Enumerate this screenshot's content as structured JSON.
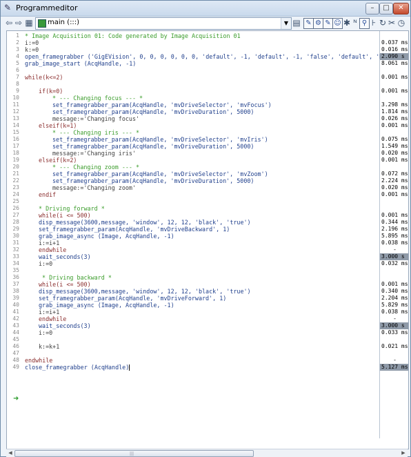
{
  "window": {
    "title": "Programmeditor"
  },
  "toolbar": {
    "procedure": "main (:::)"
  },
  "code_lines": [
    {
      "n": "1",
      "t": "* Image Acquisition 01: Code generated by Image Acquisition 01",
      "k": "c-comment",
      "i": 0,
      "time": ""
    },
    {
      "n": "2",
      "t": "i:=0",
      "k": "c-assign",
      "i": 0,
      "time": "0.037 ms"
    },
    {
      "n": "3",
      "t": "k:=0",
      "k": "c-assign",
      "i": 0,
      "time": "0.016 ms"
    },
    {
      "n": "4",
      "t": "open_framegrabber ('GigEVision', 0, 0, 0, 0, 0, 0, 'default', -1, 'default', -1, 'false', 'default', 'D'",
      "k": "c-op",
      "i": 0,
      "time": "2.090 s",
      "hl": true
    },
    {
      "n": "5",
      "t": "grab_image_start (AcqHandle, -1)",
      "k": "c-op",
      "i": 0,
      "time": "8.061 ms"
    },
    {
      "n": "6",
      "t": "",
      "k": "",
      "i": 0,
      "time": ""
    },
    {
      "n": "7",
      "t": "while(k<=2)",
      "k": "c-kw",
      "i": 0,
      "time": "0.001 ms"
    },
    {
      "n": "8",
      "t": "",
      "k": "",
      "i": 0,
      "time": ""
    },
    {
      "n": "9",
      "t": "if(k=0)",
      "k": "c-kw",
      "i": 1,
      "time": "0.001 ms"
    },
    {
      "n": "10",
      "t": "* --- Changing focus --- *",
      "k": "c-comment",
      "i": 2,
      "time": ""
    },
    {
      "n": "11",
      "t": "set_framegrabber_param(AcqHandle, 'mvDriveSelector', 'mvFocus')",
      "k": "c-op",
      "i": 2,
      "time": "3.298 ms"
    },
    {
      "n": "12",
      "t": "set_framegrabber_param(AcqHandle, 'mvDriveDuration', 5000)",
      "k": "c-op",
      "i": 2,
      "time": "1.814 ms"
    },
    {
      "n": "13",
      "t": "message:='Changing focus'",
      "k": "c-assign",
      "i": 2,
      "time": "0.026 ms"
    },
    {
      "n": "14",
      "t": "elseif(k=1)",
      "k": "c-kw",
      "i": 1,
      "time": "0.001 ms"
    },
    {
      "n": "15",
      "t": "* --- Changing iris --- *",
      "k": "c-comment",
      "i": 2,
      "time": ""
    },
    {
      "n": "16",
      "t": "set_framegrabber_param(AcqHandle, 'mvDriveSelector', 'mvIris')",
      "k": "c-op",
      "i": 2,
      "time": "0.075 ms"
    },
    {
      "n": "17",
      "t": "set_framegrabber_param(AcqHandle, 'mvDriveDuration', 5000)",
      "k": "c-op",
      "i": 2,
      "time": "1.549 ms"
    },
    {
      "n": "18",
      "t": "message:='Changing iris'",
      "k": "c-assign",
      "i": 2,
      "time": "0.020 ms"
    },
    {
      "n": "19",
      "t": "elseif(k=2)",
      "k": "c-kw",
      "i": 1,
      "time": "0.001 ms"
    },
    {
      "n": "20",
      "t": "* --- Changing zoom --- *",
      "k": "c-comment",
      "i": 2,
      "time": ""
    },
    {
      "n": "21",
      "t": "set_framegrabber_param(AcqHandle, 'mvDriveSelector', 'mvZoom')",
      "k": "c-op",
      "i": 2,
      "time": "0.072 ms"
    },
    {
      "n": "22",
      "t": "set_framegrabber_param(AcqHandle, 'mvDriveDuration', 5000)",
      "k": "c-op",
      "i": 2,
      "time": "2.224 ms"
    },
    {
      "n": "23",
      "t": "message:='Changing zoom'",
      "k": "c-assign",
      "i": 2,
      "time": "0.020 ms"
    },
    {
      "n": "24",
      "t": "endif",
      "k": "c-kw",
      "i": 1,
      "time": "0.001 ms"
    },
    {
      "n": "25",
      "t": "",
      "k": "",
      "i": 0,
      "time": ""
    },
    {
      "n": "26",
      "t": "* Driving forward *",
      "k": "c-comment",
      "i": 1,
      "time": ""
    },
    {
      "n": "27",
      "t": "while(i <= 500)",
      "k": "c-kw",
      "i": 1,
      "time": "0.001 ms"
    },
    {
      "n": "28",
      "t": "disp_message(3600,message, 'window', 12, 12, 'black', 'true')",
      "k": "c-op",
      "i": 1,
      "time": "0.344 ms"
    },
    {
      "n": "29",
      "t": "set_framegrabber_param(AcqHandle, 'mvDriveBackward', 1)",
      "k": "c-op",
      "i": 1,
      "time": "2.196 ms"
    },
    {
      "n": "30",
      "t": "grab_image_async (Image, AcqHandle, -1)",
      "k": "c-op",
      "i": 1,
      "time": "5.895 ms"
    },
    {
      "n": "31",
      "t": "i:=i+1",
      "k": "c-assign",
      "i": 1,
      "time": "0.038 ms"
    },
    {
      "n": "32",
      "t": "endwhile",
      "k": "c-kw",
      "i": 1,
      "time": "-",
      "dash": true
    },
    {
      "n": "33",
      "t": "wait_seconds(3)",
      "k": "c-op",
      "i": 1,
      "time": "3.000 s",
      "hl": true
    },
    {
      "n": "34",
      "t": "i:=0",
      "k": "c-assign",
      "i": 1,
      "time": "0.032 ms"
    },
    {
      "n": "35",
      "t": "",
      "k": "",
      "i": 0,
      "time": ""
    },
    {
      "n": "36",
      "t": " * Driving backward *",
      "k": "c-comment",
      "i": 1,
      "time": ""
    },
    {
      "n": "37",
      "t": "while(i <= 500)",
      "k": "c-kw",
      "i": 1,
      "time": "0.001 ms"
    },
    {
      "n": "38",
      "t": "disp_message(3600,message, 'window', 12, 12, 'black', 'true')",
      "k": "c-op",
      "i": 1,
      "time": "0.340 ms"
    },
    {
      "n": "39",
      "t": "set_framegrabber_param(AcqHandle, 'mvDriveForward', 1)",
      "k": "c-op",
      "i": 1,
      "time": "2.204 ms"
    },
    {
      "n": "40",
      "t": "grab_image_async (Image, AcqHandle, -1)",
      "k": "c-op",
      "i": 1,
      "time": "5.829 ms"
    },
    {
      "n": "41",
      "t": "i:=i+1",
      "k": "c-assign",
      "i": 1,
      "time": "0.038 ms"
    },
    {
      "n": "42",
      "t": "endwhile",
      "k": "c-kw",
      "i": 1,
      "time": "-",
      "dash": true
    },
    {
      "n": "43",
      "t": "wait_seconds(3)",
      "k": "c-op",
      "i": 1,
      "time": "3.000 s",
      "hl": true
    },
    {
      "n": "44",
      "t": "i:=0",
      "k": "c-assign",
      "i": 1,
      "time": "0.033 ms"
    },
    {
      "n": "45",
      "t": "",
      "k": "",
      "i": 0,
      "time": ""
    },
    {
      "n": "46",
      "t": "k:=k+1",
      "k": "c-assign",
      "i": 1,
      "time": "0.021 ms"
    },
    {
      "n": "47",
      "t": "",
      "k": "",
      "i": 0,
      "time": ""
    },
    {
      "n": "48",
      "t": "endwhile",
      "k": "c-kw",
      "i": 0,
      "time": "-",
      "dash": true
    },
    {
      "n": "49",
      "t": "close_framegrabber (AcqHandle)",
      "k": "c-op",
      "i": 0,
      "time": "5.127 ms",
      "hl": true,
      "caret": true
    }
  ],
  "colors": {
    "comment": "#3a9c2a",
    "keyword": "#8a2d2d",
    "operator": "#1f3f8c",
    "time_highlight": "#8f9aa8",
    "pc_arrow": "#2e9c2e"
  },
  "icons": {
    "back": "arrow-left-icon",
    "forward": "arrow-right-icon",
    "procedure_tree": "procedure-tree-icon",
    "pc_marker": "program-counter-arrow-icon"
  }
}
